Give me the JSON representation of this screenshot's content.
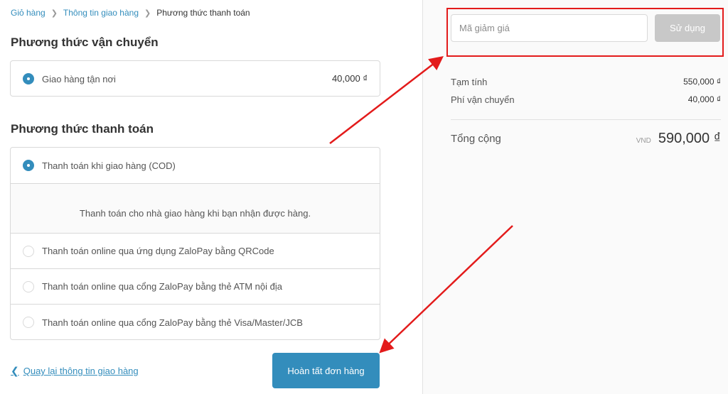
{
  "breadcrumb": {
    "cart": "Giỏ hàng",
    "shipping_info": "Thông tin giao hàng",
    "current": "Phương thức thanh toán"
  },
  "shipping": {
    "title": "Phương thức vận chuyển",
    "option_label": "Giao hàng tận nơi",
    "option_price": "40,000 ₫"
  },
  "payment": {
    "title": "Phương thức thanh toán",
    "options": [
      {
        "label": "Thanh toán khi giao hàng (COD)",
        "selected": true
      },
      {
        "label": "Thanh toán online qua ứng dụng ZaloPay bằng QRCode",
        "selected": false
      },
      {
        "label": "Thanh toán online qua cổng ZaloPay bằng thẻ ATM nội địa",
        "selected": false
      },
      {
        "label": "Thanh toán online qua cổng ZaloPay bằng thẻ Visa/Master/JCB",
        "selected": false
      }
    ],
    "cod_description": "Thanh toán cho nhà giao hàng khi bạn nhận được hàng."
  },
  "footer": {
    "back_label": "Quay lại thông tin giao hàng",
    "complete_label": "Hoàn tất đơn hàng"
  },
  "summary": {
    "discount_placeholder": "Mã giảm giá",
    "apply_label": "Sử dụng",
    "subtotal_label": "Tạm tính",
    "subtotal_value": "550,000 ₫",
    "shipping_label": "Phí vận chuyển",
    "shipping_value": "40,000 ₫",
    "total_label": "Tổng cộng",
    "currency": "VND",
    "total_value": "590,000 ₫"
  },
  "colors": {
    "accent": "#338dbc",
    "annotation_red": "#e31b1b",
    "apply_disabled": "#c8c8c8"
  }
}
